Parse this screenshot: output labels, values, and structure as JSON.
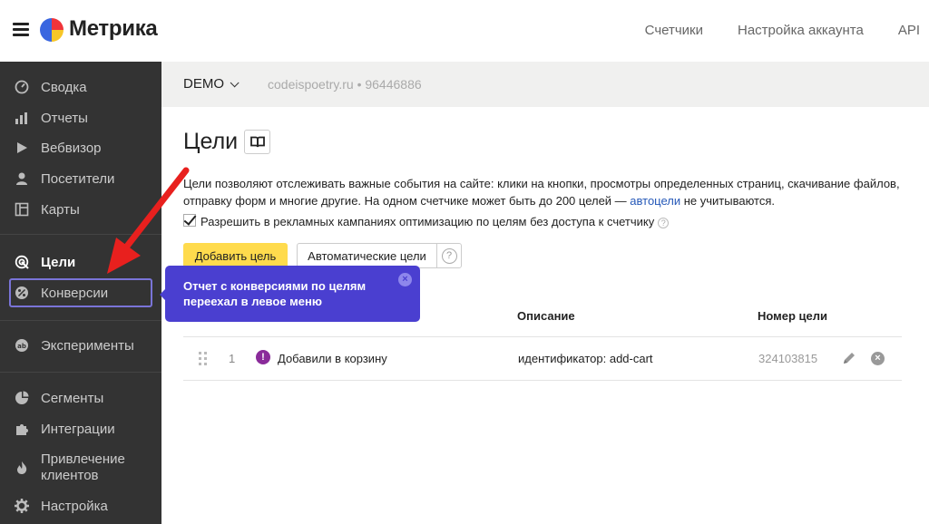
{
  "header": {
    "brand": "Метрика",
    "nav": [
      "Счетчики",
      "Настройка аккаунта",
      "API"
    ]
  },
  "sidebar": {
    "items": [
      {
        "label": "Сводка",
        "icon": "gauge-icon"
      },
      {
        "label": "Отчеты",
        "icon": "bar-chart-icon"
      },
      {
        "label": "Вебвизор",
        "icon": "play-icon"
      },
      {
        "label": "Посетители",
        "icon": "user-icon"
      },
      {
        "label": "Карты",
        "icon": "map-icon"
      },
      {
        "label": "Цели",
        "icon": "target-icon"
      },
      {
        "label": "Конверсии",
        "icon": "percent-icon"
      },
      {
        "label": "Эксперименты",
        "icon": "ab-icon"
      },
      {
        "label": "Сегменты",
        "icon": "pie-icon"
      },
      {
        "label": "Интеграции",
        "icon": "puzzle-icon"
      },
      {
        "label": "Привлечение клиентов",
        "icon": "flame-icon"
      },
      {
        "label": "Настройка",
        "icon": "gear-icon"
      }
    ]
  },
  "counter": {
    "name": "DEMO",
    "site": "codeispoetry.ru • 96446886"
  },
  "main": {
    "title": "Цели",
    "description_part1": "Цели позволяют отслеживать важные события на сайте: клики на кнопки, просмотры определенных страниц, скачивание файлов, отправку форм и многие другие. На одном счетчике может быть до 200 целей — ",
    "description_link": "автоцели",
    "description_part2": " не учитываются.",
    "checkbox_label": "Разрешить в рекламных кампаниях оптимизацию по целям без доступа к счетчику",
    "checkbox_checked": true,
    "help_glyph": "?",
    "add_button": "Добавить цель",
    "auto_button": "Автоматические цели"
  },
  "tooltip": {
    "text": "Отчет с конверсиями по целям переехал в левое меню",
    "close_glyph": "×"
  },
  "table": {
    "headers": {
      "description": "Описание",
      "goal_id": "Номер цели"
    },
    "rows": [
      {
        "num": "1",
        "status_glyph": "!",
        "name": "Добавили в корзину",
        "description": "идентификатор: add-cart",
        "goal_id": "324103815"
      }
    ],
    "delete_glyph": "×"
  },
  "colors": {
    "sidebar_bg": "#333333",
    "accent_yellow": "#ffdb4d",
    "tooltip_bg": "#4a3fd0",
    "arrow_red": "#e8201e",
    "highlight_border": "#7a74d8",
    "link": "#2558b8"
  }
}
